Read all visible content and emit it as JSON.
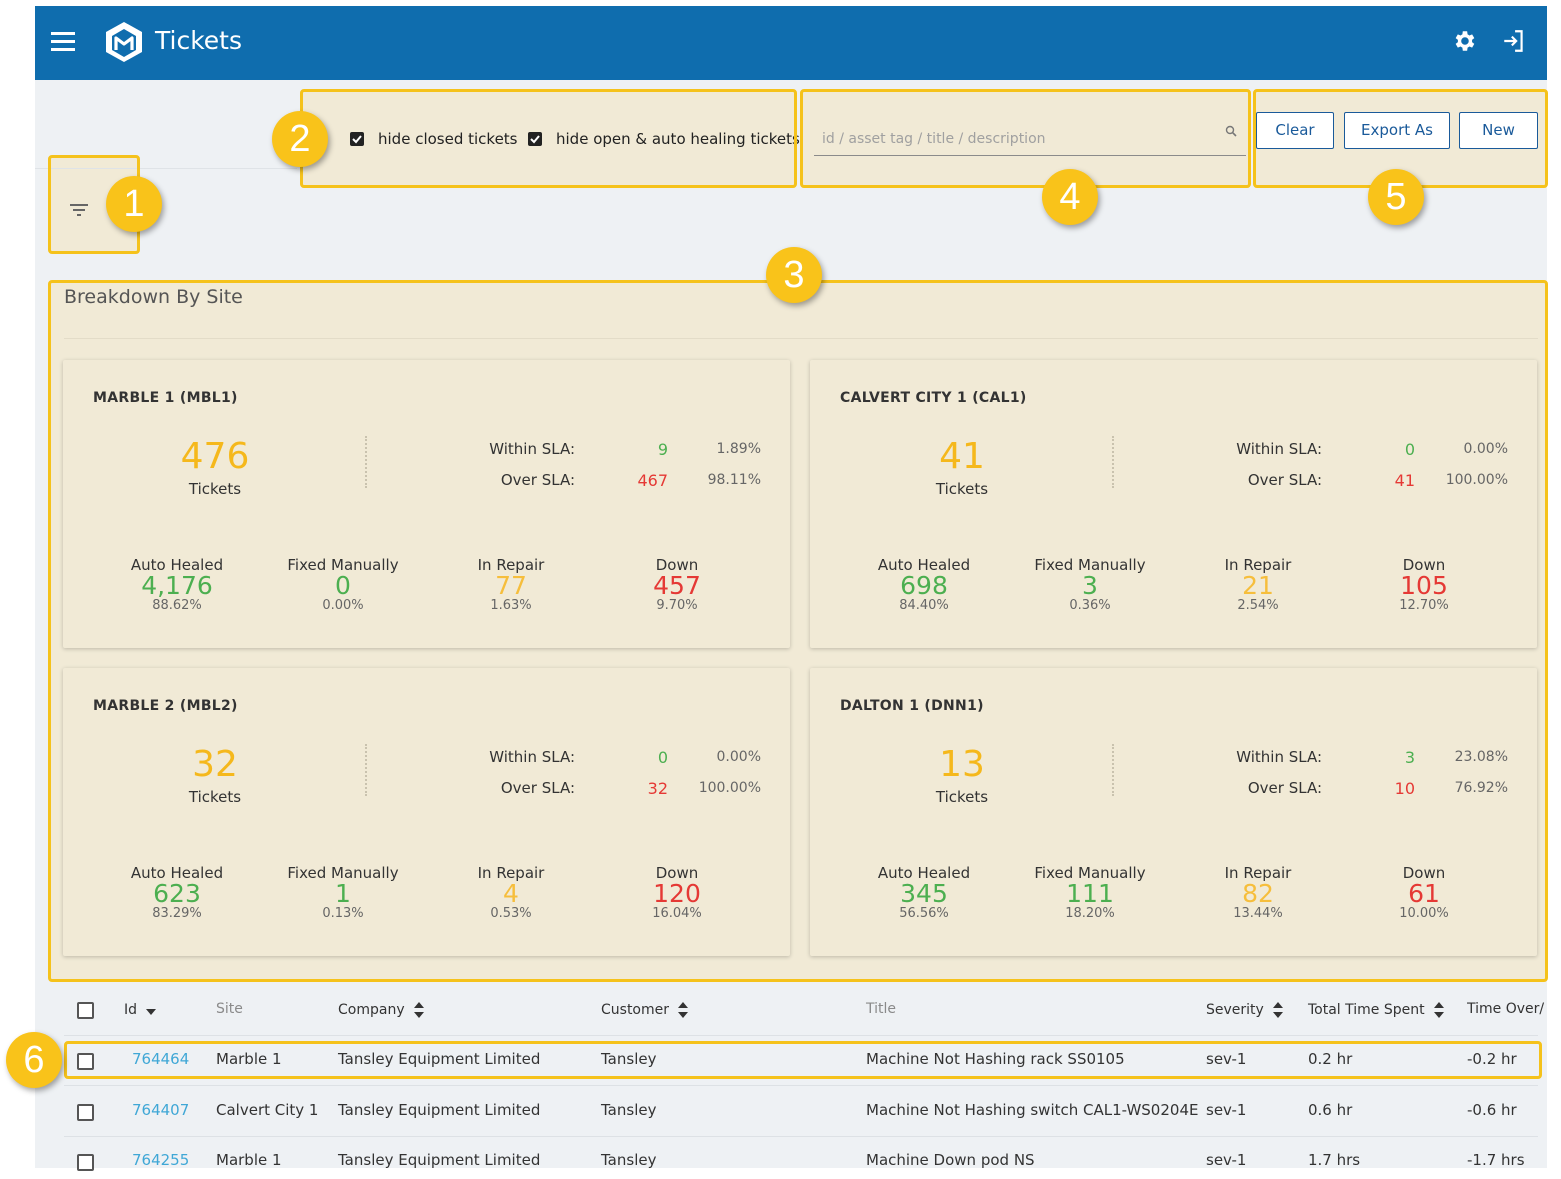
{
  "header": {
    "title": "Tickets",
    "menu_icon": "hamburger-menu-icon",
    "logo_icon": "hexagon-logo-icon",
    "settings_icon": "gear-icon",
    "logout_icon": "logout-icon",
    "bg_color": "#0f6dae"
  },
  "annotation_badges": [
    "1",
    "2",
    "3",
    "4",
    "5",
    "6"
  ],
  "annotation_color": "#f5c21b",
  "filters": {
    "filter_icon": "filter-icon",
    "hide_closed_label": "hide closed tickets",
    "hide_closed_checked": true,
    "hide_open_label": "hide open & auto healing tickets",
    "hide_open_checked": true
  },
  "search": {
    "placeholder": "id / asset tag / title / description",
    "value": ""
  },
  "actions": {
    "clear_label": "Clear",
    "export_label": "Export As",
    "new_label": "New"
  },
  "breakdown": {
    "title": "Breakdown By Site",
    "sites": [
      {
        "name": "MARBLE 1 (MBL1)",
        "tickets": "476",
        "tickets_label": "Tickets",
        "within_label": "Within SLA:",
        "within_value": "9",
        "within_pct": "1.89%",
        "over_label": "Over SLA:",
        "over_value": "467",
        "over_pct": "98.11%",
        "stats": [
          {
            "label": "Auto Healed",
            "value": "4,176",
            "pct": "88.62%"
          },
          {
            "label": "Fixed Manually",
            "value": "0",
            "pct": "0.00%"
          },
          {
            "label": "In Repair",
            "value": "77",
            "pct": "1.63%"
          },
          {
            "label": "Down",
            "value": "457",
            "pct": "9.70%"
          }
        ]
      },
      {
        "name": "CALVERT CITY 1 (CAL1)",
        "tickets": "41",
        "tickets_label": "Tickets",
        "within_label": "Within SLA:",
        "within_value": "0",
        "within_pct": "0.00%",
        "over_label": "Over SLA:",
        "over_value": "41",
        "over_pct": "100.00%",
        "stats": [
          {
            "label": "Auto Healed",
            "value": "698",
            "pct": "84.40%"
          },
          {
            "label": "Fixed Manually",
            "value": "3",
            "pct": "0.36%"
          },
          {
            "label": "In Repair",
            "value": "21",
            "pct": "2.54%"
          },
          {
            "label": "Down",
            "value": "105",
            "pct": "12.70%"
          }
        ]
      },
      {
        "name": "MARBLE 2 (MBL2)",
        "tickets": "32",
        "tickets_label": "Tickets",
        "within_label": "Within SLA:",
        "within_value": "0",
        "within_pct": "0.00%",
        "over_label": "Over SLA:",
        "over_value": "32",
        "over_pct": "100.00%",
        "stats": [
          {
            "label": "Auto Healed",
            "value": "623",
            "pct": "83.29%"
          },
          {
            "label": "Fixed Manually",
            "value": "1",
            "pct": "0.13%"
          },
          {
            "label": "In Repair",
            "value": "4",
            "pct": "0.53%"
          },
          {
            "label": "Down",
            "value": "120",
            "pct": "16.04%"
          }
        ]
      },
      {
        "name": "DALTON 1 (DNN1)",
        "tickets": "13",
        "tickets_label": "Tickets",
        "within_label": "Within SLA:",
        "within_value": "3",
        "within_pct": "23.08%",
        "over_label": "Over SLA:",
        "over_value": "10",
        "over_pct": "76.92%",
        "stats": [
          {
            "label": "Auto Healed",
            "value": "345",
            "pct": "56.56%"
          },
          {
            "label": "Fixed Manually",
            "value": "111",
            "pct": "18.20%"
          },
          {
            "label": "In Repair",
            "value": "82",
            "pct": "13.44%"
          },
          {
            "label": "Down",
            "value": "61",
            "pct": "10.00%"
          }
        ]
      }
    ]
  },
  "table": {
    "columns": [
      "Id",
      "Site",
      "Company",
      "Customer",
      "Title",
      "Severity",
      "Total Time Spent",
      "Time Over/"
    ],
    "rows": [
      {
        "id": "764464",
        "site": "Marble 1",
        "company": "Tansley Equipment Limited",
        "customer": "Tansley",
        "title": "Machine Not Hashing rack SS0105",
        "severity": "sev-1",
        "time_spent": "0.2 hr",
        "time_over": "-0.2 hr"
      },
      {
        "id": "764407",
        "site": "Calvert City 1",
        "company": "Tansley Equipment Limited",
        "customer": "Tansley",
        "title": "Machine Not Hashing switch CAL1-WS0204E",
        "severity": "sev-1",
        "time_spent": "0.6 hr",
        "time_over": "-0.6 hr"
      },
      {
        "id": "764255",
        "site": "Marble 1",
        "company": "Tansley Equipment Limited",
        "customer": "Tansley",
        "title": "Machine Down pod NS",
        "severity": "sev-1",
        "time_spent": "1.7 hrs",
        "time_over": "-1.7 hrs"
      }
    ]
  }
}
